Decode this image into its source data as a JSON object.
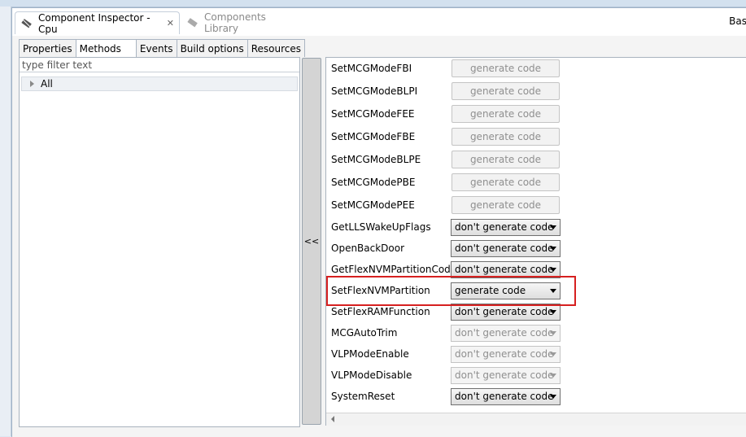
{
  "tabs": {
    "inspector": "Component Inspector - Cpu",
    "library": "Components Library",
    "right_partial": "Bas"
  },
  "subtabs": [
    "Properties",
    "Methods",
    "Events",
    "Build options",
    "Resources"
  ],
  "filter": {
    "placeholder": "type filter text"
  },
  "tree": {
    "all": "All"
  },
  "collapse_label": "<<",
  "methods": [
    {
      "name": "SetMCGModeFBI",
      "value": "generate code"
    },
    {
      "name": "SetMCGModeBLPI",
      "value": "generate code"
    },
    {
      "name": "SetMCGModeFEE",
      "value": "generate code"
    },
    {
      "name": "SetMCGModeFBE",
      "value": "generate code"
    },
    {
      "name": "SetMCGModeBLPE",
      "value": "generate code"
    },
    {
      "name": "SetMCGModePBE",
      "value": "generate code"
    },
    {
      "name": "SetMCGModePEE",
      "value": "generate code"
    },
    {
      "name": "GetLLSWakeUpFlags",
      "value": "don't generate code"
    },
    {
      "name": "OpenBackDoor",
      "value": "don't generate code"
    },
    {
      "name": "GetFlexNVMPartitionCode",
      "value": "don't generate code"
    },
    {
      "name": "SetFlexNVMPartition",
      "value": "generate code"
    },
    {
      "name": "SetFlexRAMFunction",
      "value": "don't generate code"
    },
    {
      "name": "MCGAutoTrim",
      "value": "don't generate code"
    },
    {
      "name": "VLPModeEnable",
      "value": "don't generate code"
    },
    {
      "name": "VLPModeDisable",
      "value": "don't generate code"
    },
    {
      "name": "SystemReset",
      "value": "don't generate code"
    }
  ]
}
